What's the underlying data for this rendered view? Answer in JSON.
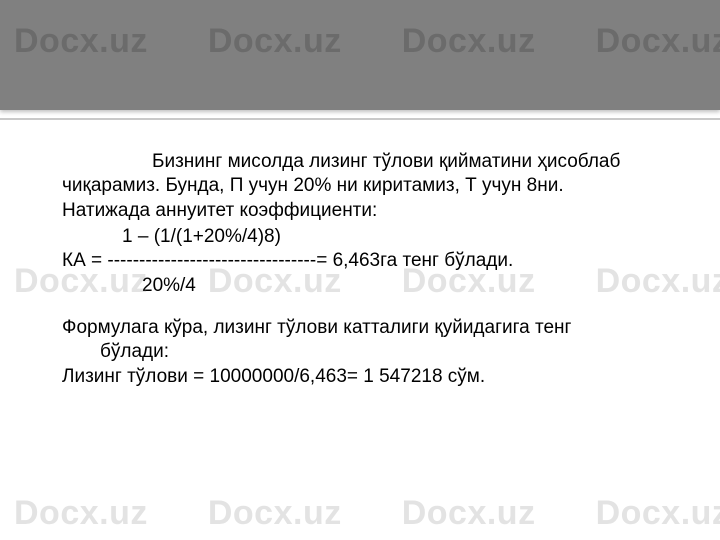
{
  "watermark": "Docx.uz",
  "content": {
    "para1_l1": "Бизнинг мисолда лизинг тўлови қийматини ҳисоблаб",
    "para1_l2": "чиқарамиз. Бунда, П учун 20% ни киритамиз, Т учун 8ни.",
    "para1_l3": "Натижада аннуитет коэффициенти:",
    "formula_num": "1 – (1/(1+20%/4)8)",
    "formula_ka": "КА = ---------------------------------= 6,463га тенг бўлади.",
    "formula_den": "20%/4",
    "para2_l1": "Формулага кўра, лизинг тўлови катталиги қуйидагига тенг",
    "para2_l2": "бўлади:",
    "para3": "Лизинг тўлови = 10000000/6,463= 1 547218 сўм."
  }
}
